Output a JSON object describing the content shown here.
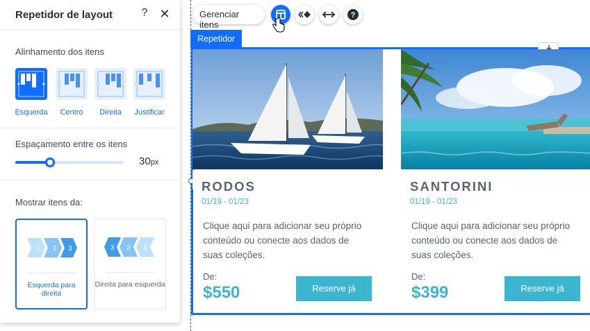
{
  "panel": {
    "title": "Repetidor de layout",
    "help_label": "?",
    "close_label": "✕",
    "alignment": {
      "label": "Alinhamento dos itens",
      "options": [
        {
          "label": "Esquerda",
          "selected": true
        },
        {
          "label": "Centro",
          "selected": false
        },
        {
          "label": "Direita",
          "selected": false
        },
        {
          "label": "Justificar",
          "selected": false
        }
      ]
    },
    "spacing": {
      "label": "Espaçamento entre os itens",
      "value": "30",
      "unit": "px",
      "fraction": 0.32
    },
    "direction": {
      "label": "Mostrar itens da:",
      "options": [
        {
          "label": "Esquerda para direita",
          "steps": [
            "1",
            "2",
            "3"
          ],
          "selected": true
        },
        {
          "label": "Direita para esquerda",
          "steps": [
            "3",
            "2",
            "1"
          ],
          "selected": false
        }
      ]
    }
  },
  "toolbar": {
    "manage_label": "Gerenciar itens",
    "icons": [
      "layout-icon",
      "animation-icon",
      "stretch-icon",
      "help-icon"
    ]
  },
  "repeater": {
    "tag": "Repetidor",
    "items": [
      {
        "title": "RODOS",
        "dates": "01/19 - 01/23",
        "description": "Clique aqui para adicionar seu próprio conteúdo ou conecte aos dados de suas coleções.",
        "price_label": "De:",
        "price": "$550",
        "button": "Reserve já"
      },
      {
        "title": "SANTORINI",
        "dates": "01/19 - 01/23",
        "description": "Clique aqui para adicionar seu próprio conteúdo ou conecte aos dados de suas coleções.",
        "price_label": "De:",
        "price": "$399",
        "button": "Reserve já"
      }
    ]
  },
  "colors": {
    "accent": "#116dff",
    "teal": "#3cb5cf",
    "title_gray": "#5b6572"
  }
}
